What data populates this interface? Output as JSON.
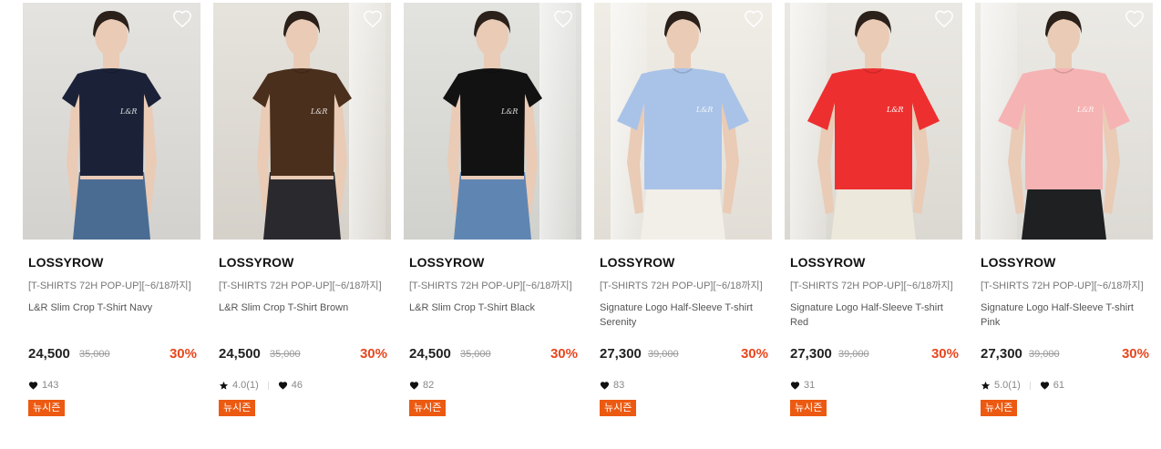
{
  "products": [
    {
      "brand": "LOSSYROW",
      "promo": "[T-SHIRTS 72H POP-UP][~6/18까지]",
      "name": "L&R Slim Crop T-Shirt Navy",
      "price": "24,500",
      "original_price": "35,000",
      "discount": "30%",
      "rating": null,
      "likes": "143",
      "badge": "뉴시즌",
      "image_icon": "product-photo-navy-crop-tee",
      "shirt_color": "#1b2238",
      "bg_color": "#dcdad6",
      "bottom_color": "#4a6c93"
    },
    {
      "brand": "LOSSYROW",
      "promo": "[T-SHIRTS 72H POP-UP][~6/18까지]",
      "name": "L&R Slim Crop T-Shirt Brown",
      "price": "24,500",
      "original_price": "35,000",
      "discount": "30%",
      "rating": "4.0(1)",
      "likes": "46",
      "badge": "뉴시즌",
      "image_icon": "product-photo-brown-crop-tee",
      "shirt_color": "#4a2f1c",
      "bg_color": "#dedad2",
      "bottom_color": "#2a2a2e"
    },
    {
      "brand": "LOSSYROW",
      "promo": "[T-SHIRTS 72H POP-UP][~6/18까지]",
      "name": "L&R Slim Crop T-Shirt Black",
      "price": "24,500",
      "original_price": "35,000",
      "discount": "30%",
      "rating": null,
      "likes": "82",
      "badge": "뉴시즌",
      "image_icon": "product-photo-black-crop-tee",
      "shirt_color": "#121212",
      "bg_color": "#d9d9d5",
      "bottom_color": "#5f86b3"
    },
    {
      "brand": "LOSSYROW",
      "promo": "[T-SHIRTS 72H POP-UP][~6/18까지]",
      "name": "Signature Logo Half-Sleeve T-shirt Serenity",
      "price": "27,300",
      "original_price": "39,000",
      "discount": "30%",
      "rating": null,
      "likes": "83",
      "badge": "뉴시즌",
      "image_icon": "product-photo-serenity-tee",
      "shirt_color": "#a9c3e8",
      "bg_color": "#ebe7df",
      "bottom_color": "#f1efe8"
    },
    {
      "brand": "LOSSYROW",
      "promo": "[T-SHIRTS 72H POP-UP][~6/18까지]",
      "name": "Signature Logo Half-Sleeve T-shirt Red",
      "price": "27,300",
      "original_price": "39,000",
      "discount": "30%",
      "rating": null,
      "likes": "31",
      "badge": "뉴시즌",
      "image_icon": "product-photo-red-tee",
      "shirt_color": "#ee2f30",
      "bg_color": "#e4e1da",
      "bottom_color": "#ede8dc"
    },
    {
      "brand": "LOSSYROW",
      "promo": "[T-SHIRTS 72H POP-UP][~6/18까지]",
      "name": "Signature Logo Half-Sleeve T-shirt Pink",
      "price": "27,300",
      "original_price": "39,000",
      "discount": "30%",
      "rating": "5.0(1)",
      "likes": "61",
      "badge": "뉴시즌",
      "image_icon": "product-photo-pink-tee",
      "shirt_color": "#f6b3b3",
      "bg_color": "#e6e3dd",
      "bottom_color": "#1e2022"
    }
  ],
  "colors": {
    "discount": "#e8461e",
    "badge_bg": "#ec5a12",
    "brand_text": "#111111"
  },
  "icons": {
    "favorite": "heart-outline-icon",
    "like": "heart-filled-icon",
    "rating": "star-filled-icon"
  }
}
